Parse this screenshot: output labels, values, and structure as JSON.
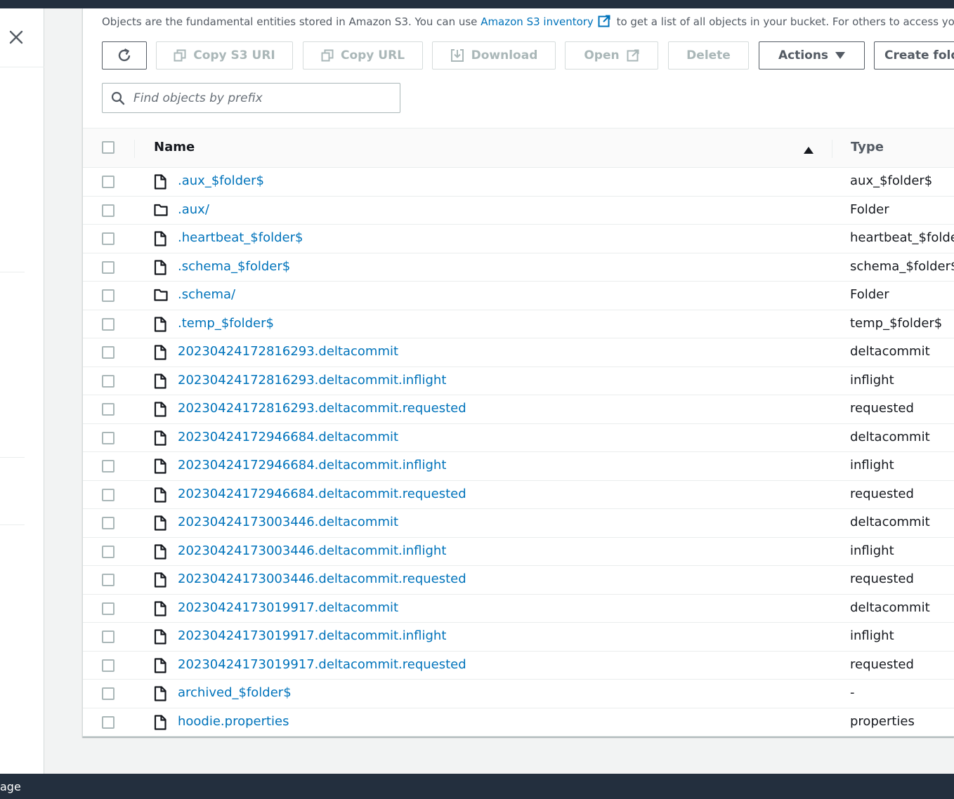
{
  "description": {
    "text_before": "Objects are the fundamental entities stored in Amazon S3. You can use ",
    "link": "Amazon S3 inventory",
    "text_after": " to get a list of all objects in your bucket. For others to access your objects, you'll need to explicitly grant them permissions."
  },
  "toolbar": {
    "copy_s3_uri": "Copy S3 URI",
    "copy_url": "Copy URL",
    "download": "Download",
    "open": "Open",
    "delete": "Delete",
    "actions": "Actions",
    "create_folder": "Create folder"
  },
  "search": {
    "placeholder": "Find objects by prefix"
  },
  "table": {
    "columns": {
      "name": "Name",
      "type": "Type"
    },
    "rows": [
      {
        "name": ".aux_$folder$",
        "type": "aux_$folder$",
        "kind": "file"
      },
      {
        "name": ".aux/",
        "type": "Folder",
        "kind": "folder"
      },
      {
        "name": ".heartbeat_$folder$",
        "type": "heartbeat_$folder$",
        "kind": "file"
      },
      {
        "name": ".schema_$folder$",
        "type": "schema_$folder$",
        "kind": "file"
      },
      {
        "name": ".schema/",
        "type": "Folder",
        "kind": "folder"
      },
      {
        "name": ".temp_$folder$",
        "type": "temp_$folder$",
        "kind": "file"
      },
      {
        "name": "20230424172816293.deltacommit",
        "type": "deltacommit",
        "kind": "file"
      },
      {
        "name": "20230424172816293.deltacommit.inflight",
        "type": "inflight",
        "kind": "file"
      },
      {
        "name": "20230424172816293.deltacommit.requested",
        "type": "requested",
        "kind": "file"
      },
      {
        "name": "20230424172946684.deltacommit",
        "type": "deltacommit",
        "kind": "file"
      },
      {
        "name": "20230424172946684.deltacommit.inflight",
        "type": "inflight",
        "kind": "file"
      },
      {
        "name": "20230424172946684.deltacommit.requested",
        "type": "requested",
        "kind": "file"
      },
      {
        "name": "20230424173003446.deltacommit",
        "type": "deltacommit",
        "kind": "file"
      },
      {
        "name": "20230424173003446.deltacommit.inflight",
        "type": "inflight",
        "kind": "file"
      },
      {
        "name": "20230424173003446.deltacommit.requested",
        "type": "requested",
        "kind": "file"
      },
      {
        "name": "20230424173019917.deltacommit",
        "type": "deltacommit",
        "kind": "file"
      },
      {
        "name": "20230424173019917.deltacommit.inflight",
        "type": "inflight",
        "kind": "file"
      },
      {
        "name": "20230424173019917.deltacommit.requested",
        "type": "requested",
        "kind": "file"
      },
      {
        "name": "archived_$folder$",
        "type": "-",
        "kind": "file"
      },
      {
        "name": "hoodie.properties",
        "type": "properties",
        "kind": "file"
      }
    ]
  },
  "footer": {
    "text": "age"
  },
  "colors": {
    "link": "#0073bb",
    "nav_dark": "#232f3e",
    "disabled": "#aab7b8",
    "border_active": "#545b64"
  }
}
